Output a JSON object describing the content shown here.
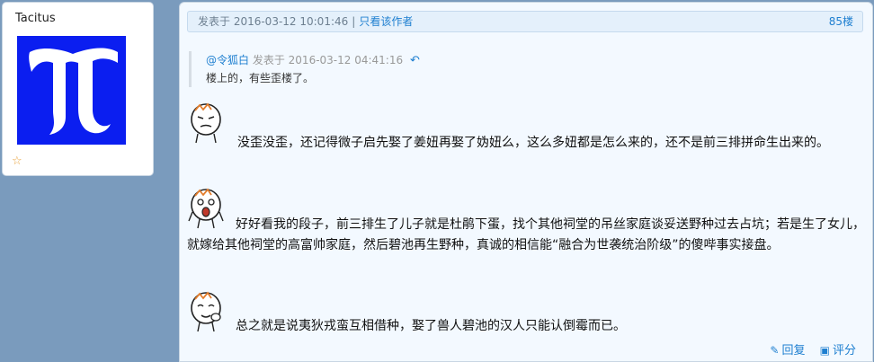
{
  "user": {
    "name": "Tacitus",
    "avatar_glyph": "T",
    "avatar_bg": "#0b1ef0"
  },
  "post": {
    "time": "发表于 2016-03-12 10:01:46",
    "separator": "|",
    "author_only": "只看该作者",
    "floor": "85楼",
    "quote": {
      "user": "@令狐白",
      "meta": "发表于 2016-03-12 04:41:16",
      "text": "楼上的，有些歪楼了。"
    },
    "paragraphs": [
      "没歪没歪，还记得微子启先娶了姜妞再娶了妫妞么，这么多妞都是怎么来的，还不是前三排拼命生出来的。",
      "好好看我的段子，前三排生了儿子就是杜鹃下蛋，找个其他祠堂的吊丝家庭谈妥送野种过去占坑；若是生了女儿，就嫁给其他祠堂的高富帅家庭，然后碧池再生野种，真诚的相信能“融合为世袭统治阶级”的傻哔事实接盘。",
      "总之就是说夷狄戎蛮互相借种，娶了兽人碧池的汉人只能认倒霉而已。"
    ],
    "actions": {
      "reply": "回复",
      "rate": "评分"
    }
  },
  "colors": {
    "page_bg": "#7a9bbd",
    "link": "#1e7fd0",
    "header_bg": "#e4f0fb"
  }
}
